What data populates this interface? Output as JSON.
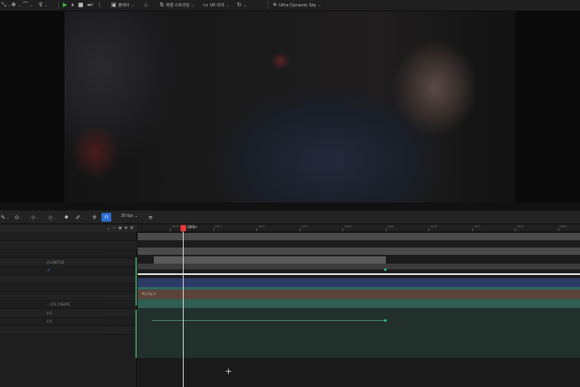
{
  "toolbar": {
    "icons": [
      "select-icon",
      "transform-icon",
      "snap-icon",
      "play-icon",
      "pause-icon",
      "stop-icon",
      "skip-forward-icon",
      "camera-icon",
      "light-icon",
      "settings-icon",
      "hdr-icon"
    ],
    "menu1": "플레이",
    "menu2": "레벨 스트리밍",
    "menu3": "VR 미리",
    "menu4": "Ultra Dynamic Sky",
    "play_color": "#3fbf3f"
  },
  "timeline": {
    "fps": "30 fps",
    "playhead_frame": "1806+",
    "ruler_ticks": [
      "1800",
      "1801",
      "1802",
      "1803",
      "1804",
      "1805",
      "1806",
      "1807",
      "1808",
      "1809"
    ],
    "playhead_color": "#e03a3a",
    "snap_color": "#2c6fd6"
  },
  "tracks": [
    {
      "label": "",
      "kind": "folder"
    },
    {
      "label": "",
      "kind": "folder"
    },
    {
      "label": "",
      "kind": "camera"
    },
    {
      "label": "Vs.000728",
      "kind": "transform"
    },
    {
      "label": "",
      "kind": "check"
    },
    {
      "label": "",
      "kind": "empty"
    },
    {
      "label": "",
      "kind": "empty"
    },
    {
      "label": "",
      "kind": "empty"
    },
    {
      "label": "...173_CREATE",
      "kind": "section"
    },
    {
      "label": "4.0",
      "kind": "value"
    },
    {
      "label": "0.0",
      "kind": "value"
    },
    {
      "label": "",
      "kind": "empty"
    }
  ],
  "clip_label": "MyClip A"
}
